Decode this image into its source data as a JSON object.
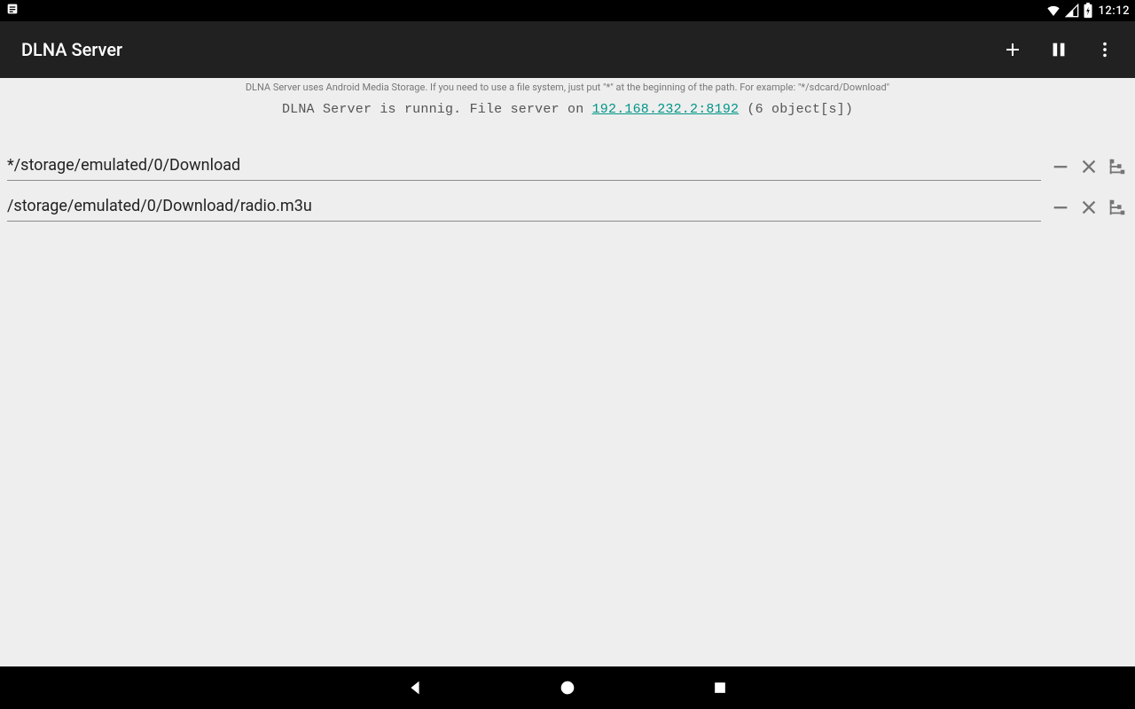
{
  "statusBar": {
    "time": "12:12"
  },
  "appBar": {
    "title": "DLNA Server"
  },
  "info": {
    "hint": "DLNA Server uses Android Media Storage. If you need to use a file system, just put \"*\" at the beginning of the path. For example: \"*/sdcard/Download\"",
    "statusPrefix": "DLNA Server is runnig. File server on ",
    "address": "192.168.232.2:8192",
    "statusSuffix": "  (6 object[s])"
  },
  "paths": [
    {
      "value": "*/storage/emulated/0/Download"
    },
    {
      "value": "/storage/emulated/0/Download/radio.m3u"
    }
  ]
}
